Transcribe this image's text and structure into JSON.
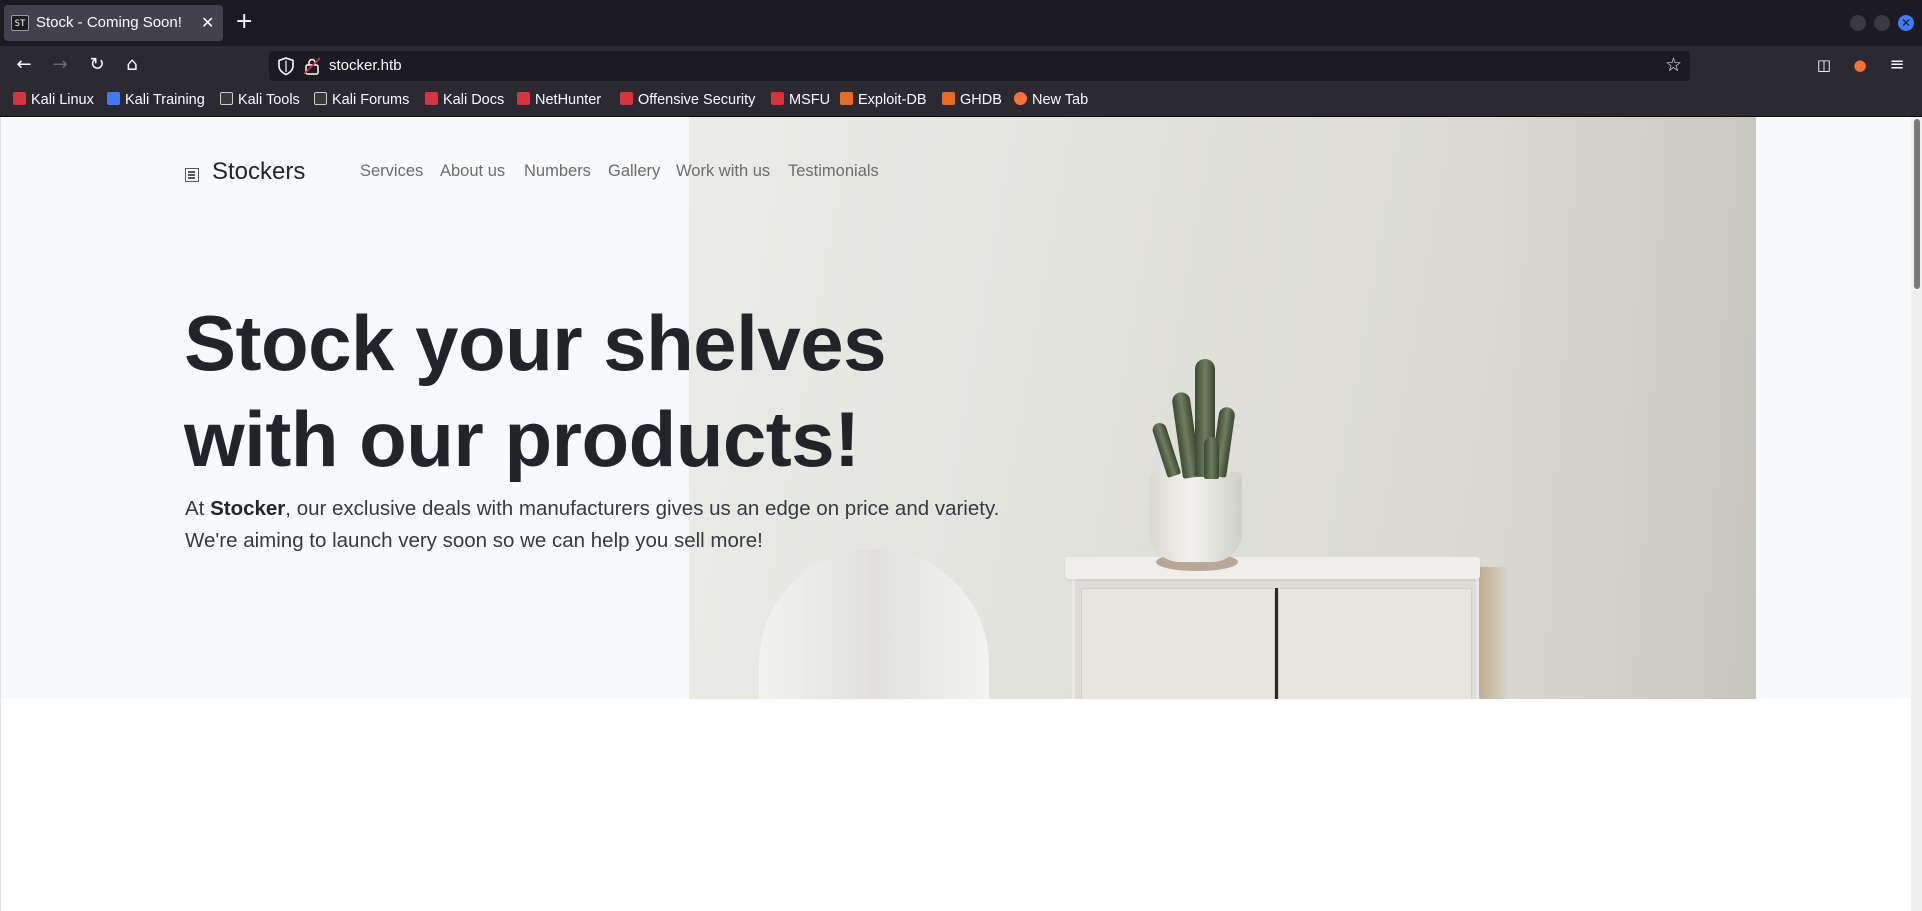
{
  "browser": {
    "tab": {
      "favicon": "ST",
      "title": "Stock - Coming Soon!"
    },
    "url": "stocker.htb",
    "bookmarks": [
      {
        "label": "Kali Linux",
        "icon": "kali-dragon-icon",
        "color": "#d9343c"
      },
      {
        "label": "Kali Training",
        "icon": "kali-training-icon",
        "color": "#3d7bfd"
      },
      {
        "label": "Kali Tools",
        "icon": "kali-tools-icon",
        "color": "#e6e6e6"
      },
      {
        "label": "Kali Forums",
        "icon": "kali-forums-icon",
        "color": "#e6e6e6"
      },
      {
        "label": "Kali Docs",
        "icon": "kali-docs-icon",
        "color": "#d9343c"
      },
      {
        "label": "NetHunter",
        "icon": "nethunter-icon",
        "color": "#d9343c"
      },
      {
        "label": "Offensive Security",
        "icon": "offsec-icon",
        "color": "#d9343c"
      },
      {
        "label": "MSFU",
        "icon": "msfu-icon",
        "color": "#d9343c"
      },
      {
        "label": "Exploit-DB",
        "icon": "exploit-db-icon",
        "color": "#e86b25"
      },
      {
        "label": "GHDB",
        "icon": "ghdb-icon",
        "color": "#e86b25"
      },
      {
        "label": "New Tab",
        "icon": "firefox-icon",
        "color": "#ff7139"
      }
    ]
  },
  "site": {
    "brand": "Stockers",
    "nav": [
      "Services",
      "About us",
      "Numbers",
      "Gallery",
      "Work with us",
      "Testimonials"
    ],
    "headline_line1": "Stock your shelves",
    "headline_line2": "with our products!",
    "lead_prefix": "At ",
    "lead_brand": "Stocker",
    "lead_rest": ", our exclusive deals with manufacturers gives us an edge on price and variety. We're aiming to launch very soon so we can help you sell more!"
  }
}
